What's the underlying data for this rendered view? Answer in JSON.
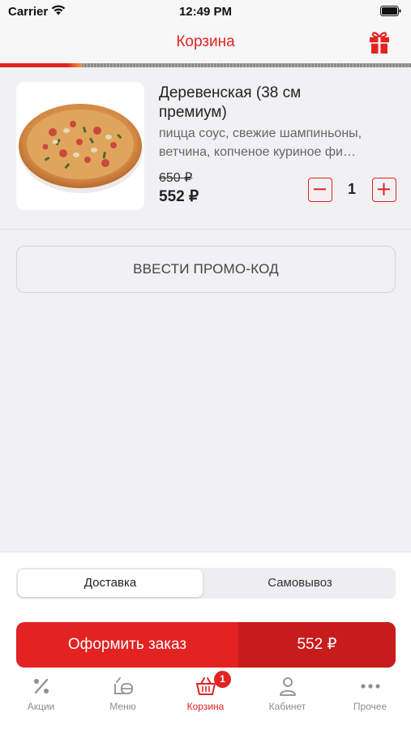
{
  "status_bar": {
    "carrier": "Carrier",
    "time": "12:49 PM"
  },
  "header": {
    "title": "Корзина"
  },
  "progress": {
    "fraction": 0.2
  },
  "cart": {
    "items": [
      {
        "name": "Деревенская (38 см премиум)",
        "description": "пицца соус, свежие шампиньоны, ветчина, копченое куриное фи…",
        "old_price": "650 ₽",
        "price": "552 ₽",
        "quantity": "1"
      }
    ]
  },
  "promo": {
    "label": "ВВЕСТИ ПРОМО-КОД"
  },
  "order_type": {
    "delivery_label": "Доставка",
    "pickup_label": "Самовывоз",
    "selected": "delivery"
  },
  "checkout": {
    "label": "Оформить заказ",
    "total": "552 ₽"
  },
  "tabs": [
    {
      "label": "Акции",
      "icon": "percent-icon"
    },
    {
      "label": "Меню",
      "icon": "menu-icon"
    },
    {
      "label": "Корзина",
      "icon": "basket-icon",
      "badge": "1"
    },
    {
      "label": "Кабинет",
      "icon": "user-icon"
    },
    {
      "label": "Прочее",
      "icon": "more-icon"
    }
  ],
  "colors": {
    "accent": "#e32222",
    "accent_dark": "#c81c1c",
    "inactive": "#8e8e93",
    "background": "#f1f1f3"
  }
}
